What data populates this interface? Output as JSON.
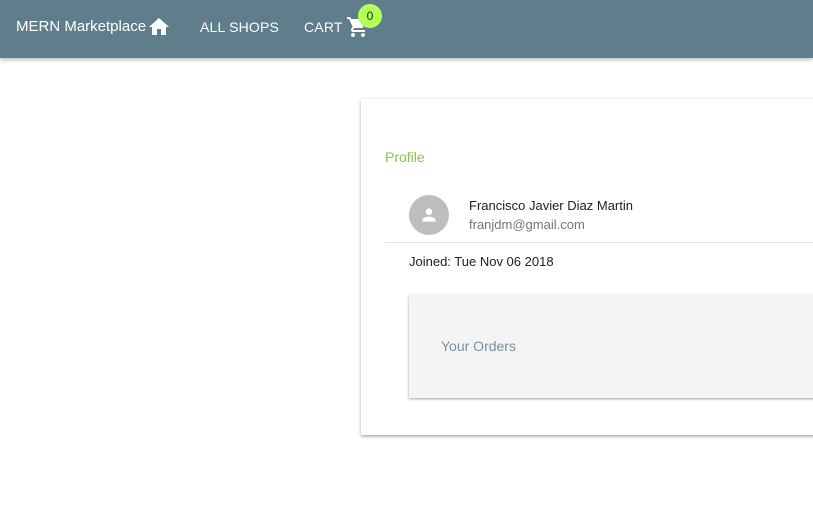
{
  "appbar": {
    "brand": "MERN Marketplace",
    "home_icon": "home-icon",
    "links": {
      "all_shops": "ALL SHOPS",
      "cart": "CART"
    },
    "cart_icon": "shopping-cart-icon",
    "cart_count": "0",
    "colors": {
      "background": "#607d8b",
      "badge": "#b2ff59"
    }
  },
  "profile": {
    "title": "Profile",
    "avatar_icon": "person-icon",
    "name": "Francisco Javier Diaz Martin",
    "email": "franjdm@gmail.com",
    "joined": "Joined: Tue Nov 06 2018",
    "accent_color": "#8bc34a"
  },
  "orders": {
    "title": "Your Orders"
  }
}
